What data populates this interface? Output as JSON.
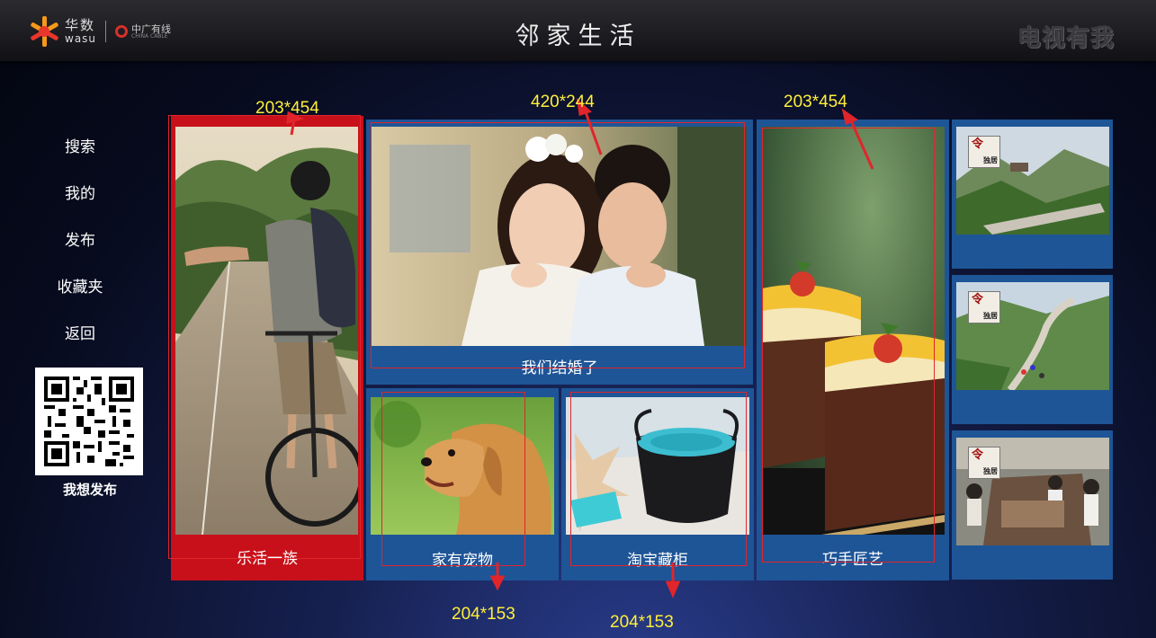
{
  "header": {
    "brand_cn": "华数",
    "brand_en": "wasu",
    "partner": "中广有线",
    "partner_en": "CHINA CABLE",
    "title": "邻家生活",
    "slogan": "电视有我"
  },
  "sidebar": {
    "items": [
      {
        "label": "搜索"
      },
      {
        "label": "我的"
      },
      {
        "label": "发布"
      },
      {
        "label": "收藏夹"
      },
      {
        "label": "返回"
      }
    ],
    "qr_label": "我想发布"
  },
  "tiles": {
    "cycling": {
      "caption": "乐活一族"
    },
    "wedding": {
      "caption": "我们结婚了"
    },
    "pets": {
      "caption": "家有宠物"
    },
    "treasure": {
      "caption": "淘宝藏柜"
    },
    "crafts": {
      "caption": "巧手匠艺"
    },
    "mountain1": {
      "badge_top": "令",
      "badge_bottom": "独居"
    },
    "mountain2": {
      "badge_top": "令",
      "badge_bottom": "独居"
    },
    "market": {
      "badge_top": "令",
      "badge_bottom": "独居"
    }
  },
  "annotations": {
    "cycling_size": "203*454",
    "wedding_size": "420*244",
    "crafts_size": "203*454",
    "pets_size": "204*153",
    "treasure_size": "204*153"
  },
  "colors": {
    "tile_blue": "#1e5597",
    "tile_focus_red": "#c8101a",
    "annotation_yellow": "#ffef3a",
    "guide_red": "#e0252b"
  }
}
